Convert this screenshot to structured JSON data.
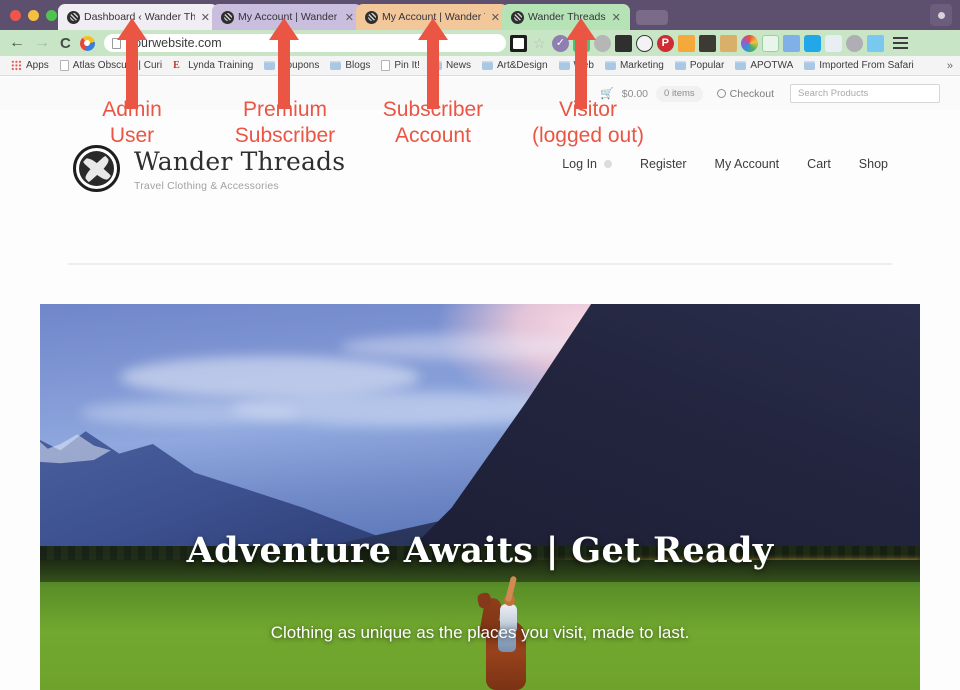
{
  "browser": {
    "window_controls": [
      "close",
      "minimize",
      "zoom"
    ],
    "tabs": [
      {
        "title": "Dashboard ‹ Wander Threa",
        "favicon": "wander-threads-favicon",
        "close": "✕",
        "color": "#f0eef2"
      },
      {
        "title": "My Account | Wander Thre",
        "favicon": "wander-threads-favicon",
        "close": "✕",
        "color": "#c9bede"
      },
      {
        "title": "My Account | Wander Thre",
        "favicon": "wander-threads-favicon",
        "close": "✕",
        "color": "#f2c79a"
      },
      {
        "title": "Wander Threads",
        "favicon": "wander-threads-favicon",
        "close": "✕",
        "color": "#b6e3b6"
      }
    ],
    "toolbar": {
      "back": "←",
      "forward": "→",
      "reload": "C",
      "url": "yourwebsite.com",
      "extensions": [
        "reader-icon",
        "bookmark-star-icon",
        "checkmark-badge-icon",
        "robot-icon",
        "refresh-circle-icon",
        "layers-icon",
        "slash-circle-icon",
        "pinterest-icon",
        "analytics-on-icon",
        "dark-square-icon",
        "tan-tool-icon",
        "color-wheel-icon",
        "recycle-icon",
        "translate-icon",
        "evernote-icon",
        "badge-icon",
        "grey-ball-icon",
        "calendar-icon"
      ],
      "menu": "hamburger-menu-icon"
    },
    "bookmarks": [
      {
        "label": "Apps",
        "icon": "apps-grid-icon"
      },
      {
        "label": "Atlas Obscura | Curi",
        "icon": "page-icon"
      },
      {
        "label": "Lynda Training",
        "icon": "lynda-e-icon"
      },
      {
        "label": "Coupons",
        "icon": "folder-icon"
      },
      {
        "label": "Blogs",
        "icon": "folder-icon"
      },
      {
        "label": "Pin It!",
        "icon": "page-icon"
      },
      {
        "label": "News",
        "icon": "folder-icon"
      },
      {
        "label": "Art&Design",
        "icon": "folder-icon"
      },
      {
        "label": "Web",
        "icon": "folder-icon"
      },
      {
        "label": "Marketing",
        "icon": "folder-icon"
      },
      {
        "label": "Popular",
        "icon": "folder-icon"
      },
      {
        "label": "APOTWA",
        "icon": "folder-icon"
      },
      {
        "label": "Imported From Safari",
        "icon": "folder-icon"
      }
    ],
    "bookmarks_overflow": "»"
  },
  "annotations": {
    "accent_color": "#ea5544",
    "items": [
      {
        "label": "Admin\nUser"
      },
      {
        "label": "Premium\nSubscriber"
      },
      {
        "label": "Subscriber\nAccount"
      },
      {
        "label": "Visitor\n(logged out)"
      }
    ]
  },
  "site": {
    "utility_bar": {
      "cart_icon": "shopping-cart-icon",
      "cart_total": "$0.00",
      "cart_items": "0 items",
      "checkout_label": "Checkout",
      "search_placeholder": "Search Products"
    },
    "brand": {
      "logo": "wander-threads-logo",
      "name": "Wander Threads",
      "tagline": "Travel Clothing & Accessories"
    },
    "nav": [
      {
        "label": "Log In",
        "has_dot": true
      },
      {
        "label": "Register",
        "has_dot": false
      },
      {
        "label": "My Account",
        "has_dot": false
      },
      {
        "label": "Cart",
        "has_dot": false
      },
      {
        "label": "Shop",
        "has_dot": false
      }
    ],
    "hero": {
      "title": "Adventure Awaits | Get Ready",
      "subtitle": "Clothing as unique as the places you visit, made to last.",
      "image_description": "mountain-valley-horse-rider-photo"
    }
  }
}
